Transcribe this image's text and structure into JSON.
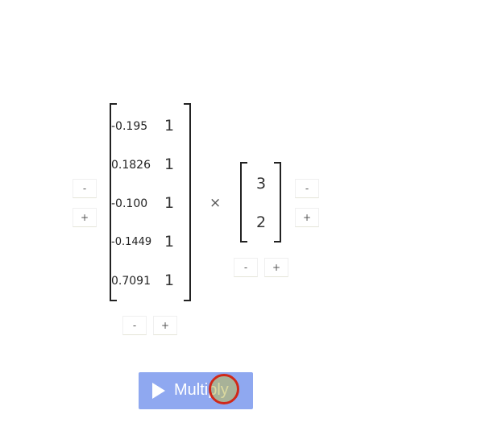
{
  "matrixA": {
    "col1": [
      "-0.195",
      "0.1826",
      "-0.100",
      "-0.1449",
      "0.7091"
    ],
    "col2": [
      "1",
      "1",
      "1",
      "1",
      "1"
    ]
  },
  "matrixB": {
    "values": [
      "3",
      "2"
    ]
  },
  "operator": "×",
  "controls": {
    "minus_label": "-",
    "plus_label": "+"
  },
  "multiply_button": {
    "label": "Multiply"
  }
}
